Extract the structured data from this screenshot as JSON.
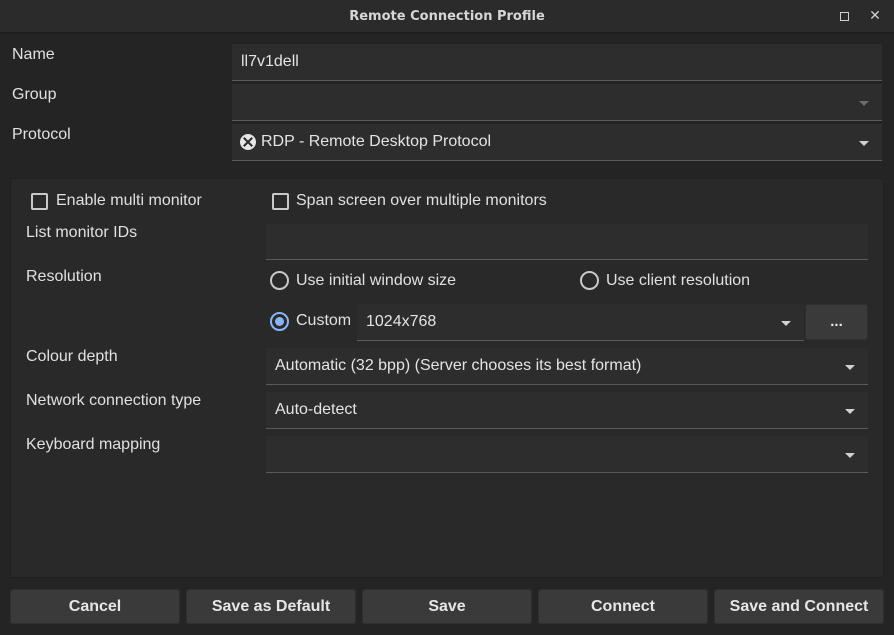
{
  "window": {
    "title": "Remote Connection Profile"
  },
  "form": {
    "name_label": "Name",
    "name_value": "ll7v1dell",
    "group_label": "Group",
    "group_value": "",
    "protocol_label": "Protocol",
    "protocol_value": "RDP - Remote Desktop Protocol",
    "protocol_icon": "rdp-icon"
  },
  "display": {
    "enable_multi_monitor": {
      "label": "Enable multi monitor",
      "checked": false
    },
    "span_screen": {
      "label": "Span screen over multiple monitors",
      "checked": false
    },
    "list_monitor_ids_label": "List monitor IDs",
    "list_monitor_ids_value": "",
    "resolution_label": "Resolution",
    "res_initial": {
      "label": "Use initial window size",
      "checked": false
    },
    "res_client": {
      "label": "Use client resolution",
      "checked": false
    },
    "res_custom": {
      "label": "Custom",
      "checked": true
    },
    "custom_value": "1024x768",
    "more_label": "...",
    "colour_depth_label": "Colour depth",
    "colour_depth_value": "Automatic (32 bpp) (Server chooses its best format)",
    "network_label": "Network connection type",
    "network_value": "Auto-detect",
    "keyboard_label": "Keyboard mapping",
    "keyboard_value": ""
  },
  "buttons": {
    "cancel": "Cancel",
    "save_default": "Save as Default",
    "save": "Save",
    "connect": "Connect",
    "save_connect": "Save and Connect"
  },
  "colors": {
    "accent": "#8ab4f8",
    "background": "#242424"
  }
}
